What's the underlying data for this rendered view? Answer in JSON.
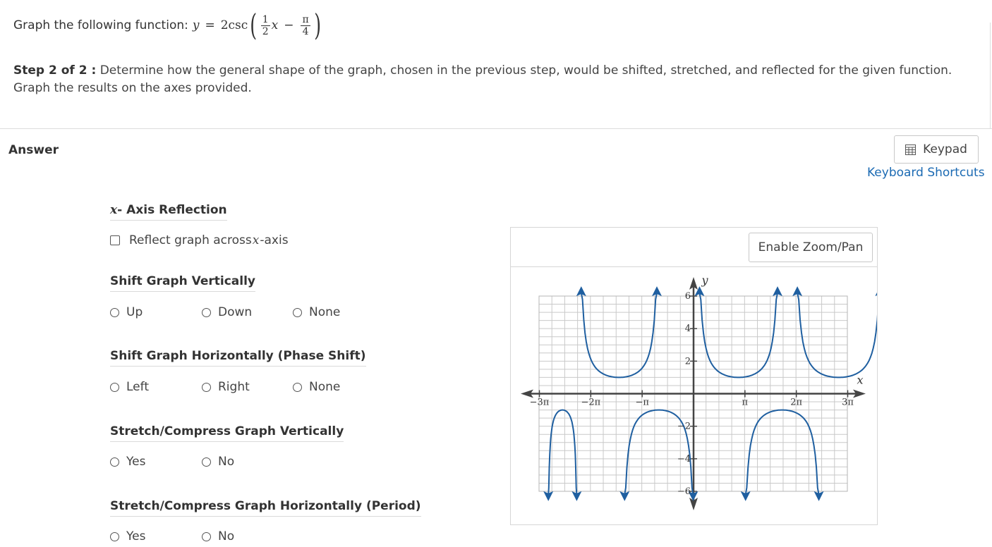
{
  "question": {
    "prompt": "Graph the following function:",
    "var_y": "y",
    "equals": "=",
    "coef_func": "2csc",
    "frac1_num": "1",
    "frac1_den": "2",
    "var_x": "x",
    "minus": "−",
    "frac2_num": "π",
    "frac2_den": "4"
  },
  "step": {
    "label": "Step 2 of 2 :",
    "text": "Determine how the general shape of the graph, chosen in the previous step, would be shifted, stretched, and reflected for the given function. Graph the results on the axes provided."
  },
  "answer_label": "Answer",
  "keypad_label": "Keypad",
  "shortcuts_label": "Keyboard Shortcuts",
  "sections": {
    "reflection": {
      "title_prefix": "x",
      "title_rest": "- Axis Reflection",
      "checkbox_pre": "Reflect graph across ",
      "checkbox_var": "x",
      "checkbox_post": "-axis"
    },
    "vertical_shift": {
      "title": "Shift Graph Vertically",
      "options": [
        "Up",
        "Down",
        "None"
      ]
    },
    "horizontal_shift": {
      "title": "Shift Graph Horizontally (Phase Shift)",
      "options": [
        "Left",
        "Right",
        "None"
      ]
    },
    "vertical_stretch": {
      "title": "Stretch/Compress Graph Vertically",
      "options": [
        "Yes",
        "No"
      ]
    },
    "horizontal_stretch": {
      "title": "Stretch/Compress Graph Horizontally (Period)",
      "options": [
        "Yes",
        "No"
      ]
    }
  },
  "graph": {
    "zoom_button": "Enable Zoom/Pan",
    "x_axis_label": "x",
    "y_axis_label": "y",
    "x_ticks": [
      "−3π",
      "−2π",
      "−π",
      "π",
      "2π",
      "3π"
    ],
    "y_ticks": [
      "6",
      "4",
      "2",
      "−2",
      "−4",
      "−6"
    ],
    "curve_color": "#1f5fa0",
    "x_range": [
      "−3π",
      "3π"
    ],
    "y_range": [
      -6,
      6
    ]
  }
}
